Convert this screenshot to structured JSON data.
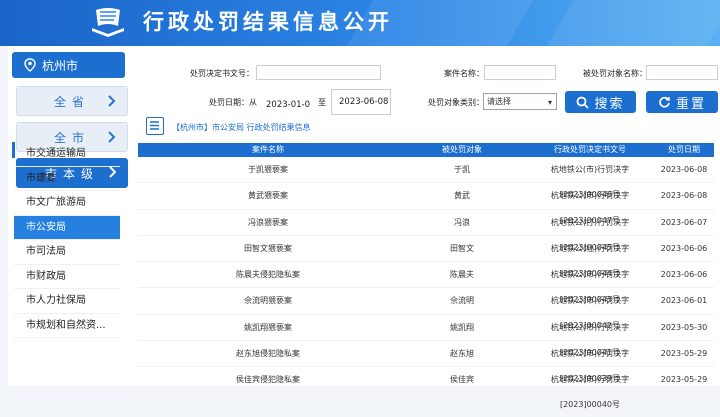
{
  "header": {
    "title": "行政处罚结果信息公开"
  },
  "sidebar": {
    "city": "杭州市",
    "levels": [
      {
        "label": "全省"
      },
      {
        "label": "全市"
      },
      {
        "label": "市本级"
      }
    ],
    "departments": [
      "市交通运输局",
      "市建委",
      "市文广旅游局",
      "市公安局",
      "市司法局",
      "市财政局",
      "市人力社保局",
      "市规划和自然资..."
    ]
  },
  "search": {
    "doc_no_label": "处罚决定书文号：",
    "case_name_label": "案件名称：",
    "target_name_label": "被处罚对象名称：",
    "date_label": "处罚日期：从",
    "date_from": "2023-01-01",
    "date_to_label": "至",
    "date_to": "2023-06-08",
    "target_type_label": "处罚对象类别：",
    "target_type_value": "请选择",
    "search_button": "搜索",
    "reset_button": "重置"
  },
  "breadcrumb": "【杭州市】市公安局 行政处罚结果信息",
  "table": {
    "headers": [
      "案件名称",
      "被处罚对象",
      "行政处罚决定书文号",
      "处罚日期"
    ],
    "rows": [
      [
        "于凯猥亵案",
        "于凯",
        "杭地铁公(市)行罚决字[2023]00046号",
        "2023-06-08"
      ],
      [
        "黄武猥亵案",
        "黄武",
        "杭地铁公(市)行罚决字[2023]00047号",
        "2023-06-08"
      ],
      [
        "冯浪猥亵案",
        "冯浪",
        "杭地铁公(打)行罚决字[2023]00045号",
        "2023-06-07"
      ],
      [
        "田智文猥亵案",
        "田智文",
        "杭地铁公(杜)行罚决字[2023]00044号",
        "2023-06-06"
      ],
      [
        "陈晨夫侵犯隐私案",
        "陈晨夫",
        "杭地铁公(市)行罚决字[2023]00043号",
        "2023-06-06"
      ],
      [
        "佘流明猥亵案",
        "佘流明",
        "杭地铁公(市)行罚决字[2023]00042号",
        "2023-06-01"
      ],
      [
        "姚凯翔猥亵案",
        "姚凯翔",
        "杭地铁公(市)行罚决字[2023]00041号",
        "2023-05-30"
      ],
      [
        "赵东旭侵犯隐私案",
        "赵东旭",
        "杭地铁公(市)行罚决字[2023]00039号",
        "2023-05-29"
      ],
      [
        "侯佳宾侵犯隐私案",
        "侯佳宾",
        "杭地铁公(市)行罚决字[2023]00040号",
        "2023-05-29"
      ]
    ]
  }
}
